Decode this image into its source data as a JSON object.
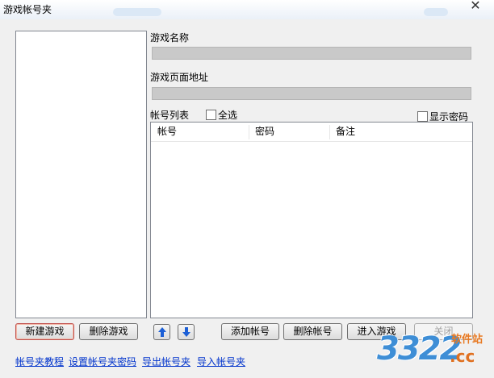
{
  "window": {
    "title": "游戏帐号夹"
  },
  "form": {
    "game_name_label": "游戏名称",
    "game_name_value": "",
    "game_url_label": "游戏页面地址",
    "game_url_value": "",
    "account_list_label": "帐号列表",
    "select_all_label": "全选",
    "show_password_label": "显示密码"
  },
  "table": {
    "columns": [
      "帐号",
      "密码",
      "备注"
    ],
    "rows": []
  },
  "buttons": {
    "new_game": "新建游戏",
    "delete_game": "删除游戏",
    "add_account": "添加帐号",
    "delete_account": "删除帐号",
    "enter_game": "进入游戏",
    "close": "关闭"
  },
  "links": {
    "tutorial": "帐号夹教程",
    "set_password": "设置帐号夹密码",
    "export": "导出帐号夹",
    "import": "导入帐号夹"
  },
  "watermark": {
    "number": "3322",
    "suffix": ".cc",
    "site_label": "软件站"
  },
  "colors": {
    "accent_link": "#0033cc",
    "arrow": "#1c5fd6",
    "field_disabled": "#c9c9c9"
  }
}
